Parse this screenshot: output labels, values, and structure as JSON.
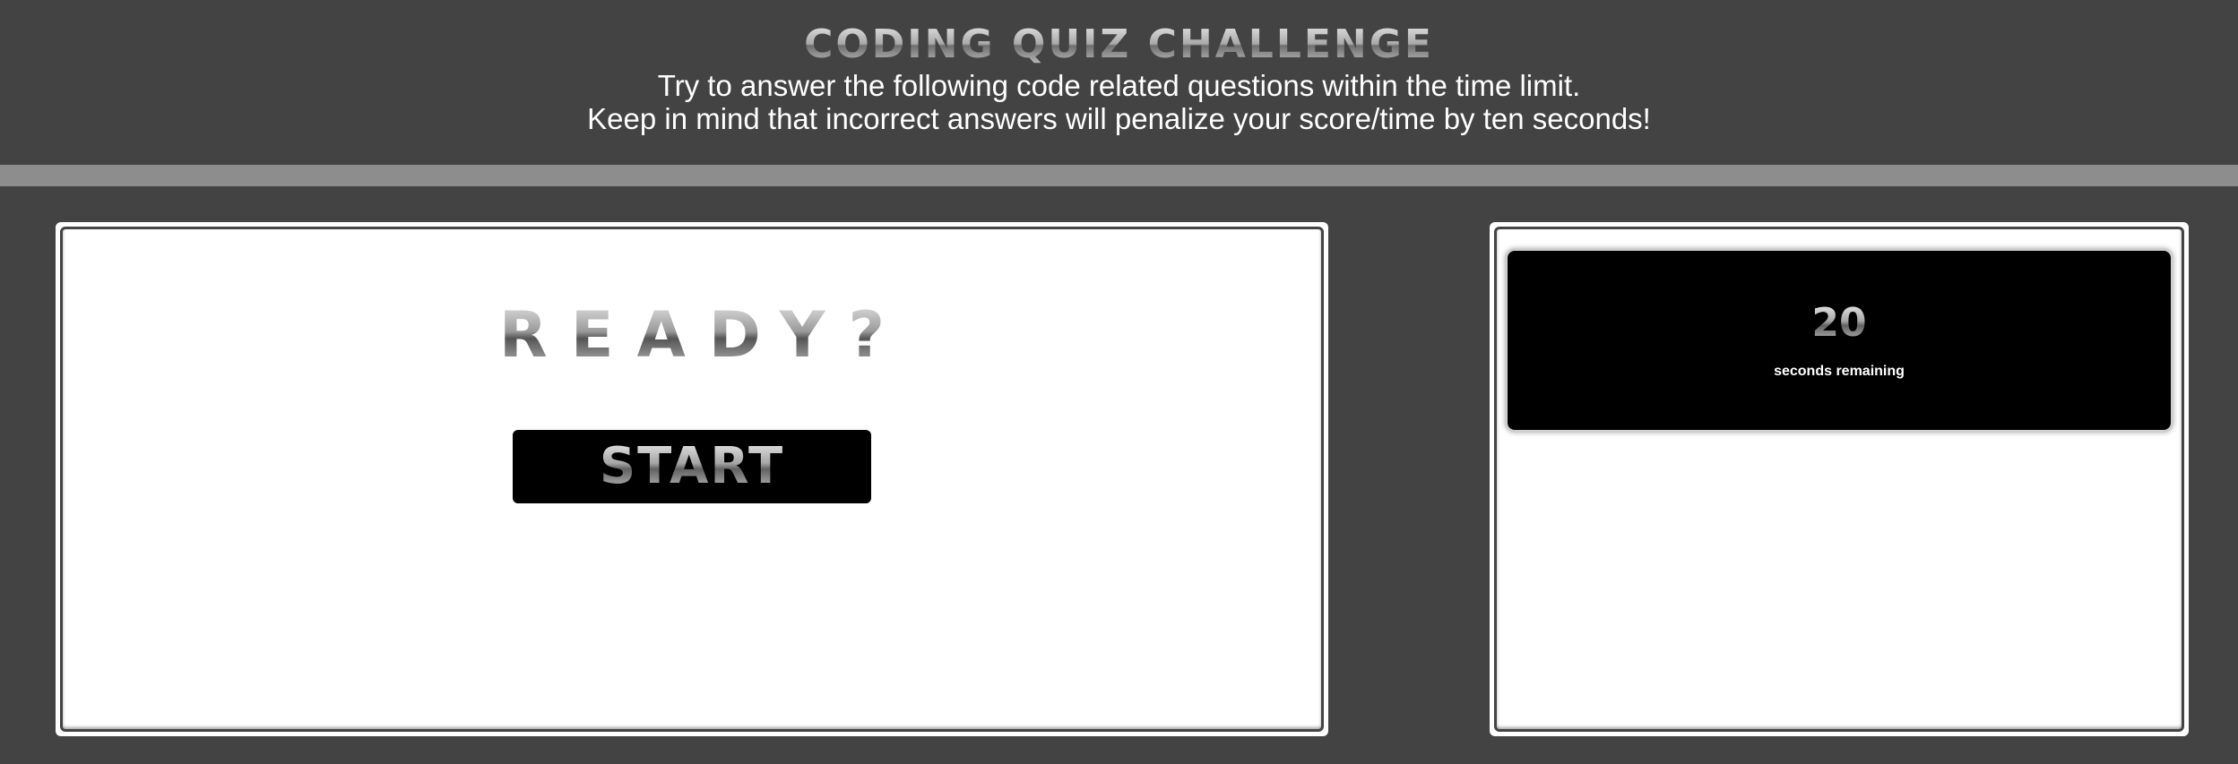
{
  "header": {
    "title": "CODING QUIZ CHALLENGE",
    "subtitle_line1": "Try to answer the following code related questions within the time limit.",
    "subtitle_line2": "Keep in mind that incorrect answers will penalize your score/time by ten seconds!"
  },
  "quiz": {
    "heading": "READY?",
    "start_label": "START"
  },
  "timer": {
    "count": "20",
    "label": "seconds remaining"
  },
  "colors": {
    "background": "#434343",
    "divider": "#8d8d8d",
    "panel": "#ffffff",
    "button": "#000000",
    "text_light": "#ffffff"
  }
}
